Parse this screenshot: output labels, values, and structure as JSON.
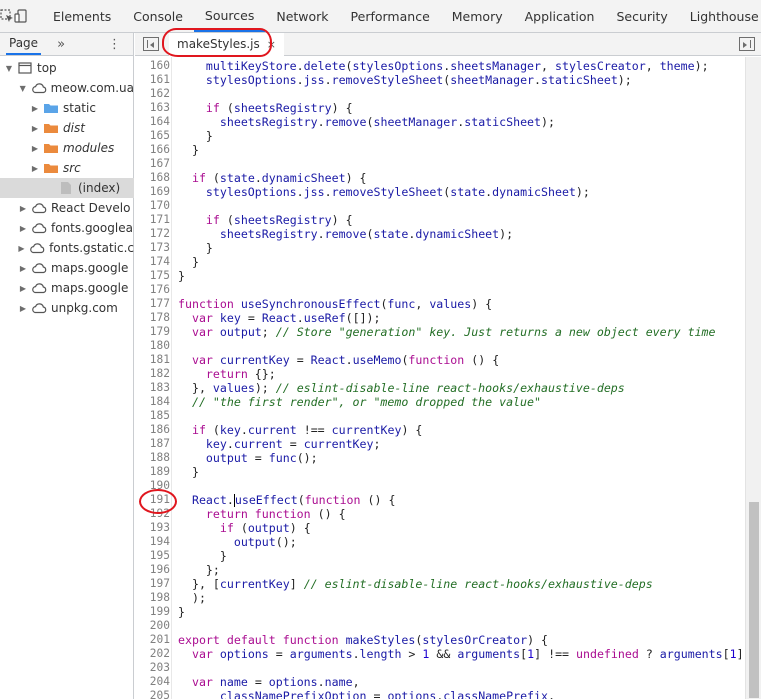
{
  "toolbar": {
    "icons": [
      "inspect-icon",
      "device-toggle-icon"
    ],
    "tabs": [
      "Elements",
      "Console",
      "Sources",
      "Network",
      "Performance",
      "Memory",
      "Application",
      "Security",
      "Lighthouse"
    ],
    "active_tab": "Sources",
    "more": "»"
  },
  "navigator": {
    "tab": "Page",
    "more": "»",
    "menu": "⋮",
    "tree": [
      {
        "label": "top",
        "level": 0,
        "expanded": true,
        "icon": "frame-icon"
      },
      {
        "label": "meow.com.ua",
        "level": 1,
        "expanded": true,
        "icon": "cloud-icon"
      },
      {
        "label": "static",
        "level": 2,
        "expanded": false,
        "icon": "folder-blue-icon"
      },
      {
        "label": "dist",
        "level": 2,
        "expanded": false,
        "icon": "folder-orange-icon",
        "italic": true
      },
      {
        "label": "modules",
        "level": 2,
        "expanded": false,
        "icon": "folder-orange-icon",
        "italic": true
      },
      {
        "label": "src",
        "level": 2,
        "expanded": false,
        "icon": "folder-orange-icon",
        "italic": true
      },
      {
        "label": "(index)",
        "level": 3,
        "expanded": null,
        "icon": "file-icon",
        "selected": true
      },
      {
        "label": "React Develo",
        "level": 1,
        "expanded": false,
        "icon": "cloud-icon"
      },
      {
        "label": "fonts.googlea",
        "level": 1,
        "expanded": false,
        "icon": "cloud-icon"
      },
      {
        "label": "fonts.gstatic.c",
        "level": 1,
        "expanded": false,
        "icon": "cloud-icon"
      },
      {
        "label": "maps.google",
        "level": 1,
        "expanded": false,
        "icon": "cloud-icon"
      },
      {
        "label": "maps.google",
        "level": 1,
        "expanded": false,
        "icon": "cloud-icon"
      },
      {
        "label": "unpkg.com",
        "level": 1,
        "expanded": false,
        "icon": "cloud-icon"
      }
    ]
  },
  "editor": {
    "file_tab": "makeStyles.js",
    "close": "×",
    "lines": [
      {
        "n": "160",
        "t": "    multiKeyStore.delete(stylesOptions.sheetsManager, stylesCreator, theme);"
      },
      {
        "n": "161",
        "t": "    stylesOptions.jss.removeStyleSheet(sheetManager.staticSheet);"
      },
      {
        "n": "162",
        "t": ""
      },
      {
        "n": "163",
        "t": "    if (sheetsRegistry) {"
      },
      {
        "n": "164",
        "t": "      sheetsRegistry.remove(sheetManager.staticSheet);"
      },
      {
        "n": "165",
        "t": "    }"
      },
      {
        "n": "166",
        "t": "  }"
      },
      {
        "n": "167",
        "t": ""
      },
      {
        "n": "168",
        "t": "  if (state.dynamicSheet) {"
      },
      {
        "n": "169",
        "t": "    stylesOptions.jss.removeStyleSheet(state.dynamicSheet);"
      },
      {
        "n": "170",
        "t": ""
      },
      {
        "n": "171",
        "t": "    if (sheetsRegistry) {"
      },
      {
        "n": "172",
        "t": "      sheetsRegistry.remove(state.dynamicSheet);"
      },
      {
        "n": "173",
        "t": "    }"
      },
      {
        "n": "174",
        "t": "  }"
      },
      {
        "n": "175",
        "t": "}"
      },
      {
        "n": "176",
        "t": ""
      },
      {
        "n": "177",
        "t": "function useSynchronousEffect(func, values) {"
      },
      {
        "n": "178",
        "t": "  var key = React.useRef([]);"
      },
      {
        "n": "179",
        "t": "  var output; // Store \"generation\" key. Just returns a new object every time"
      },
      {
        "n": "180",
        "t": ""
      },
      {
        "n": "181",
        "t": "  var currentKey = React.useMemo(function () {"
      },
      {
        "n": "182",
        "t": "    return {};"
      },
      {
        "n": "183",
        "t": "  }, values); // eslint-disable-line react-hooks/exhaustive-deps"
      },
      {
        "n": "184",
        "t": "  // \"the first render\", or \"memo dropped the value\""
      },
      {
        "n": "185",
        "t": ""
      },
      {
        "n": "186",
        "t": "  if (key.current !== currentKey) {"
      },
      {
        "n": "187",
        "t": "    key.current = currentKey;"
      },
      {
        "n": "188",
        "t": "    output = func();"
      },
      {
        "n": "189",
        "t": "  }"
      },
      {
        "n": "190",
        "t": ""
      },
      {
        "n": "191",
        "t": "  React.useEffect(function () {"
      },
      {
        "n": "192",
        "t": "    return function () {"
      },
      {
        "n": "193",
        "t": "      if (output) {"
      },
      {
        "n": "194",
        "t": "        output();"
      },
      {
        "n": "195",
        "t": "      }"
      },
      {
        "n": "196",
        "t": "    };"
      },
      {
        "n": "197",
        "t": "  }, [currentKey] // eslint-disable-line react-hooks/exhaustive-deps"
      },
      {
        "n": "198",
        "t": "  );"
      },
      {
        "n": "199",
        "t": "}"
      },
      {
        "n": "200",
        "t": ""
      },
      {
        "n": "201",
        "t": "export default function makeStyles(stylesOrCreator) {"
      },
      {
        "n": "202",
        "t": "  var options = arguments.length > 1 && arguments[1] !== undefined ? arguments[1] : {}"
      },
      {
        "n": "203",
        "t": ""
      },
      {
        "n": "204",
        "t": "  var name = options.name,"
      },
      {
        "n": "205",
        "t": "      classNamePrefixOption = options.classNamePrefix,"
      }
    ]
  },
  "colors": {
    "accent": "#1a73e8",
    "annotation": "#e0161e",
    "keyword": "#aa0d91",
    "comment": "#236e25",
    "literal": "#1c00cf"
  }
}
